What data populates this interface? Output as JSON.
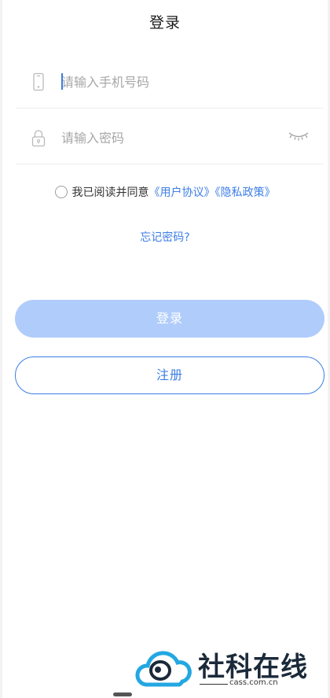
{
  "header": {
    "title": "登录"
  },
  "phone_field": {
    "placeholder": "请输入手机号码",
    "value": "",
    "icon": "phone-icon"
  },
  "password_field": {
    "placeholder": "请输入密码",
    "value": "",
    "icon": "lock-icon",
    "toggle_icon": "eye-closed-icon"
  },
  "agreement": {
    "checked": false,
    "prefix": "我已阅读并同意",
    "user_agreement": "《用户协议》",
    "privacy_policy": "《隐私政策》"
  },
  "forgot_password": "忘记密码?",
  "buttons": {
    "login": "登录",
    "register": "注册"
  },
  "watermark": {
    "name": "社科在线",
    "domain": "cass.com.cn"
  },
  "colors": {
    "accent": "#3d7ee6",
    "login_button_disabled": "#b0ccfb",
    "placeholder": "#a7a7a7",
    "divider": "#eeeeee"
  }
}
